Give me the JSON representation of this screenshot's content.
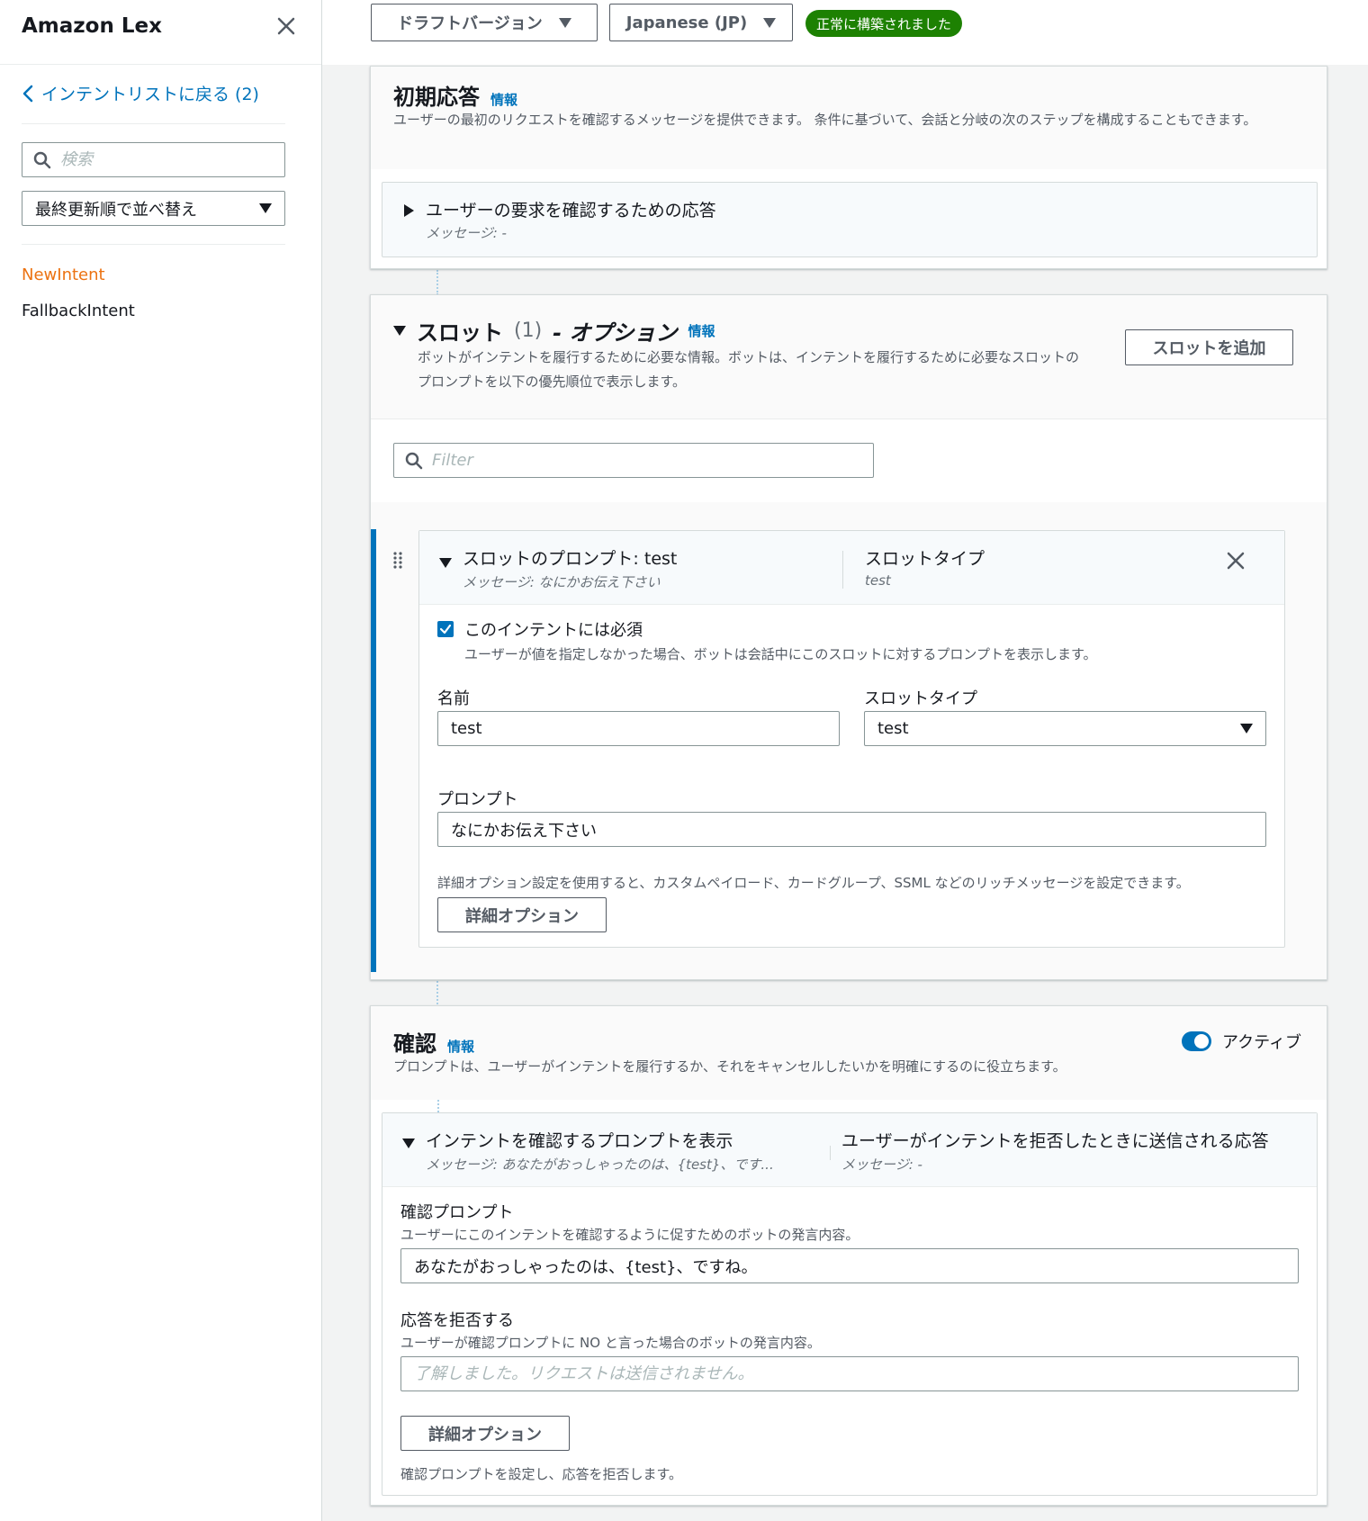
{
  "sidebar": {
    "title": "Amazon Lex",
    "back_label": "インテントリストに戻る (2)",
    "search_placeholder": "検索",
    "sort_label": "最終更新順で並べ替え",
    "items": [
      {
        "label": "NewIntent",
        "active": true
      },
      {
        "label": "FallbackIntent",
        "active": false
      }
    ]
  },
  "topbar": {
    "version_label": "ドラフトバージョン",
    "language_label": "Japanese (JP)",
    "status_label": "正常に構築されました",
    "status_color": "#1d8102"
  },
  "initial_response": {
    "title": "初期応答",
    "info": "情報",
    "description": "ユーザーの最初のリクエストを確認するメッセージを提供できます。 条件に基づいて、会話と分岐の次のステップを構成することもできます。",
    "card_title": "ユーザーの要求を確認するための応答",
    "card_sub": "メッセージ: -"
  },
  "slots": {
    "title_prefix": "スロット",
    "count": "(1)",
    "title_suffix": "- オプション",
    "info": "情報",
    "description": "ボットがインテントを履行するために必要な情報。ボットは、インテントを履行するために必要なスロットのプロンプトを以下の優先順位で表示します。",
    "add_button": "スロットを追加",
    "filter_placeholder": "Filter",
    "slot": {
      "prompt_heading": "スロットのプロンプト: test",
      "prompt_sub": "メッセージ: なにかお伝え下さい",
      "type_heading": "スロットタイプ",
      "type_sub": "test",
      "required_label": "このインテントには必須",
      "required_checked": true,
      "required_desc": "ユーザーが値を指定しなかった場合、ボットは会話中にこのスロットに対するプロンプトを表示します。",
      "name_label": "名前",
      "name_value": "test",
      "type_label": "スロットタイプ",
      "type_value": "test",
      "prompt_label": "プロンプト",
      "prompt_value": "なにかお伝え下さい",
      "advanced_desc": "詳細オプション設定を使用すると、カスタムペイロード、カードグループ、SSML などのリッチメッセージを設定できます。",
      "advanced_button": "詳細オプション"
    }
  },
  "confirmation": {
    "title": "確認",
    "info": "情報",
    "toggle_label": "アクティブ",
    "toggle_on": true,
    "accent_color": "#0073bb",
    "description": "プロンプトは、ユーザーがインテントを履行するか、それをキャンセルしたいかを明確にするのに役立ちます。",
    "card_title": "インテントを確認するプロンプトを表示",
    "card_sub": "メッセージ: あなたがおっしゃったのは、{test}、です...",
    "decline_heading": "ユーザーがインテントを拒否したときに送信される応答",
    "decline_sub": "メッセージ: -",
    "confirm_label": "確認プロンプト",
    "confirm_desc": "ユーザーにこのインテントを確認するように促すためのボットの発言内容。",
    "confirm_value": "あなたがおっしゃったのは、{test}、ですね。",
    "decline_label": "応答を拒否する",
    "decline_desc": "ユーザーが確認プロンプトに NO と言った場合のボットの発言内容。",
    "decline_placeholder": "了解しました。リクエストは送信されません。",
    "advanced_button": "詳細オプション",
    "footer_text": "確認プロンプトを設定し、応答を拒否します。"
  }
}
